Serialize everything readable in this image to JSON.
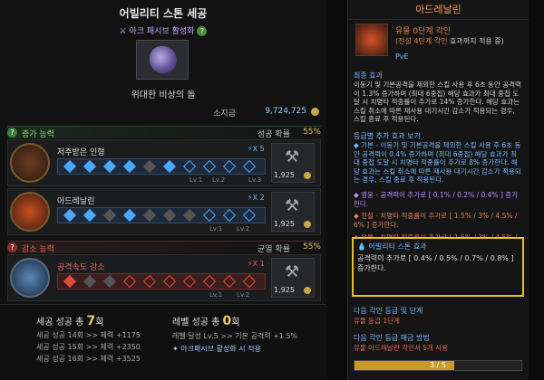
{
  "left": {
    "title": "어빌리티 스톤 세공",
    "passive_label": "아크 패시브 활성화",
    "stone_name": "위대한 비상의 돌",
    "gold_label": "소지금",
    "gold_value": "9,724,725",
    "increase": {
      "header": "증가 능력",
      "rate_label": "성공 확률",
      "rate_value": "55%",
      "rows": [
        {
          "name": "저주받은 인형",
          "mult": "X 5",
          "cost": "1,925",
          "levels": [
            "Lv.1",
            "Lv.2",
            "Lv.3"
          ],
          "slots": [
            "on",
            "on",
            "on",
            "on",
            "off",
            "on",
            "o",
            "o",
            "o",
            "o"
          ]
        },
        {
          "name": "아드레날린",
          "mult": "X 2",
          "cost": "1,925",
          "levels": [
            "Lv.1",
            "Lv.2"
          ],
          "slots": [
            "on",
            "on",
            "off",
            "on",
            "off",
            "off",
            "off",
            "o",
            "o",
            "o"
          ]
        }
      ]
    },
    "decrease": {
      "header": "감소 능력",
      "rate_label": "균열 확률",
      "rate_value": "55%",
      "rows": [
        {
          "name": "공격속도 감소",
          "mult": "X 1",
          "cost": "1,925",
          "levels": [
            "Lv.1",
            "Lv.2"
          ],
          "slots": [
            "on",
            "off",
            "off",
            "o",
            "o",
            "o",
            "o",
            "o",
            "o",
            "o"
          ]
        }
      ]
    },
    "summary": {
      "success_label": "세공 성공 총",
      "success_count": "7",
      "success_unit": "회",
      "lines": [
        "세공 성공 14회 >> 체력 +1175",
        "세공 성공 15회 >> 체력 +2350",
        "세공 성공 16회 >> 체력 +3525"
      ],
      "level_label": "레벨 성공 총",
      "level_count": "0",
      "level_unit": "회",
      "level_line": "레벨 달성 Lv.5 >> 기본 공격력 +1.5%",
      "passive_note": "아크패시브 활성화 시 적용"
    }
  },
  "right": {
    "title": "아드레날린",
    "engrave": "유물 0단계 각인",
    "engrave_sub_prefix": "(전설 4단계 각인",
    "engrave_sub_suffix": " 효과까지 적용 중)",
    "tag": "PvE",
    "final_header": "최종 효과",
    "final_text": "이동기 및 기본공격을 제외한 스킬 사용 후 6초 동안 공격력이 1.3% 증가하며 (최대 6중첩) 해당 효과가 최대 중첩 도달 시 치명타 적중률이 추가로 14% 증가한다. 해당 효과는 스킬 취소에 따른 재사용 대기시간 감소가 적용되는 경우, 스킬 종료 후 적용된다.",
    "grade_header": "등급별 추가 효과 보기",
    "basic_text": "◆ 기본 - 이동기 및 기본공격을 제외한 스킬 사용 후 6초 동안 공격력이 0.4% 증가하며 (최대 6중첩) 해당 효과가 최대 중첩 도달 시 치명타 적중률이 추가로 8% 증가한다. 해당 효과는 스킬 취소에 따른 재사용 대기시간 감소가 적용되는 경우, 스킬 종료 후 적용된다.",
    "hero_text": "◆ 영웅 - 공격력이 추가로 [ 0.1% / 0.2% / 0.4% ] 증가한다.",
    "legend_text": "◆ 전설 - 치명타 적중률이 추가로 [ 1.5% / 3% / 4.5% / 6% ] 증가한다.",
    "relic_text": "◆ 유물 - 치명타 적중률이 추가로 [ 1.5% / 3% / 4.5% / 6% ] 증가한다.",
    "stone_header": "어빌리티 스톤 효과",
    "stone_text": "공격력이 추가로 [ 0.4% / 0.5% / 0.7% / 0.8% ] 증가한다.",
    "next_header": "다음 각인 등급 및 단계",
    "next_value": "유물 등급 1단계",
    "unlock_header": "다음 각인 등급 해금 방법",
    "unlock_value": "유물 아드레날린 각인서 5개 사용",
    "progress_text": "3 / 5",
    "progress_fraction": 0.6
  }
}
